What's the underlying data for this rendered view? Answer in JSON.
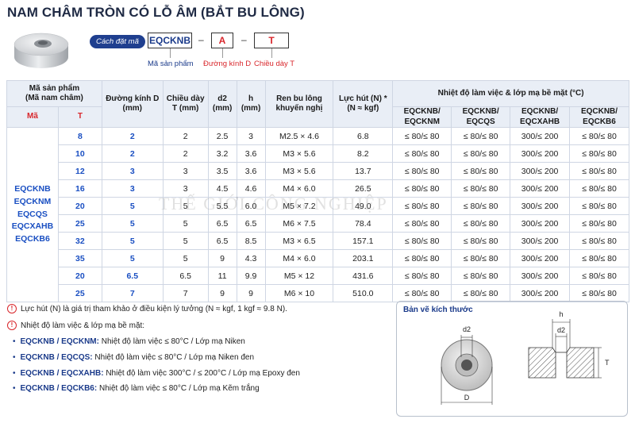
{
  "title": "NAM CHÂM TRÒN CÓ LỖ ÂM (BẮT BU LÔNG)",
  "code": {
    "label": "Cách đặt mã",
    "parts": [
      "EQCKNB",
      "A",
      "T"
    ],
    "captions": [
      "Mã sản phẩm",
      "Đường kính D",
      "Chiều dày T"
    ]
  },
  "table": {
    "headers": {
      "product": "Mã sản phẩm",
      "product_sub": "(Mã nam châm)",
      "ma": "Mã",
      "t": "T",
      "diameter": "Đường kính D",
      "diameter_unit": "(mm)",
      "thickness": "Chiều dày",
      "thickness_unit": "T (mm)",
      "d2": "d2",
      "d2_unit": "(mm)",
      "h": "h",
      "h_unit": "(mm)",
      "bolt": "Ren bu lông",
      "bolt_sub": "khuyến nghị",
      "force": "Lực hút (N) *",
      "force_sub": "(N ≈ kgf)",
      "temp_group": "Nhiệt độ làm việc & lớp mạ bề mặt (°C)",
      "temp_cols": [
        [
          "EQCKNB/",
          "EQCKNM"
        ],
        [
          "EQCKNB/",
          "EQCQS"
        ],
        [
          "EQCKNB/",
          "EQCXAHB"
        ],
        [
          "EQCKNB/",
          "EQCKB6"
        ]
      ]
    },
    "product_codes": [
      "EQCKNB",
      "EQCKNM",
      "EQCQS",
      "EQCXAHB",
      "EQCKB6"
    ],
    "rows": [
      {
        "t": "8",
        "d": "2",
        "thick": "2",
        "d2": "2.5",
        "h": "3",
        "bolt": "M2.5 × 4.6",
        "force": "6.8",
        "c1": "≤ 80/≤ 80",
        "c2": "≤ 80/≤ 80",
        "c3": "300/≤ 200",
        "c4": "≤ 80/≤ 80"
      },
      {
        "t": "10",
        "d": "2",
        "thick": "2",
        "d2": "3.2",
        "h": "3.6",
        "bolt": "M3 × 5.6",
        "force": "8.2",
        "c1": "≤ 80/≤ 80",
        "c2": "≤ 80/≤ 80",
        "c3": "300/≤ 200",
        "c4": "≤ 80/≤ 80"
      },
      {
        "t": "12",
        "d": "3",
        "thick": "3",
        "d2": "3.5",
        "h": "3.6",
        "bolt": "M3 × 5.6",
        "force": "13.7",
        "c1": "≤ 80/≤ 80",
        "c2": "≤ 80/≤ 80",
        "c3": "300/≤ 200",
        "c4": "≤ 80/≤ 80"
      },
      {
        "t": "16",
        "d": "3",
        "thick": "3",
        "d2": "4.5",
        "h": "4.6",
        "bolt": "M4 × 6.0",
        "force": "26.5",
        "c1": "≤ 80/≤ 80",
        "c2": "≤ 80/≤ 80",
        "c3": "300/≤ 200",
        "c4": "≤ 80/≤ 80"
      },
      {
        "t": "20",
        "d": "5",
        "thick": "5",
        "d2": "5.5",
        "h": "6.0",
        "bolt": "M5 × 7.2",
        "force": "49.0",
        "c1": "≤ 80/≤ 80",
        "c2": "≤ 80/≤ 80",
        "c3": "300/≤ 200",
        "c4": "≤ 80/≤ 80"
      },
      {
        "t": "25",
        "d": "5",
        "thick": "5",
        "d2": "6.5",
        "h": "6.5",
        "bolt": "M6 × 7.5",
        "force": "78.4",
        "c1": "≤ 80/≤ 80",
        "c2": "≤ 80/≤ 80",
        "c3": "300/≤ 200",
        "c4": "≤ 80/≤ 80"
      },
      {
        "t": "32",
        "d": "5",
        "thick": "5",
        "d2": "6.5",
        "h": "8.5",
        "bolt": "M3 × 6.5",
        "force": "157.1",
        "c1": "≤ 80/≤ 80",
        "c2": "≤ 80/≤ 80",
        "c3": "300/≤ 200",
        "c4": "≤ 80/≤ 80"
      },
      {
        "t": "35",
        "d": "5",
        "thick": "5",
        "d2": "9",
        "h": "4.3",
        "bolt": "M4 × 6.0",
        "force": "203.1",
        "c1": "≤ 80/≤ 80",
        "c2": "≤ 80/≤ 80",
        "c3": "300/≤ 200",
        "c4": "≤ 80/≤ 80"
      },
      {
        "t": "20",
        "d": "6.5",
        "thick": "6.5",
        "d2": "11",
        "h": "9.9",
        "bolt": "M5 × 12",
        "force": "431.6",
        "c1": "≤ 80/≤ 80",
        "c2": "≤ 80/≤ 80",
        "c3": "300/≤ 200",
        "c4": "≤ 80/≤ 80"
      },
      {
        "t": "25",
        "d": "7",
        "thick": "7",
        "d2": "9",
        "h": "9",
        "bolt": "M6 × 10",
        "force": "510.0",
        "c1": "≤ 80/≤ 80",
        "c2": "≤ 80/≤ 80",
        "c3": "300/≤ 200",
        "c4": "≤ 80/≤ 80"
      }
    ]
  },
  "watermark": "THẾ GIỚI CÔNG NGHIỆP",
  "notes": [
    "Lực hút (N) là giá trị tham khảo ở điều kiện lý tưởng (N ≈ kgf, 1 kgf ≈ 9.8 N).",
    "Nhiệt độ làm việc & lớp mạ bề mặt:"
  ],
  "bullets": [
    {
      "code": "EQCKNB / EQCKNM:",
      "text": "Nhiệt độ làm việc ≤ 80°C / Lớp mạ Niken"
    },
    {
      "code": "EQCKNB / EQCQS:",
      "text": "Nhiệt độ làm việc ≤ 80°C / Lớp mạ Niken đen"
    },
    {
      "code": "EQCKNB / EQCXAHB:",
      "text": "Nhiệt độ làm việc 300°C / ≤ 200°C / Lớp mạ Epoxy đen"
    },
    {
      "code": "EQCKNB / EQCKB6:",
      "text": "Nhiệt độ làm việc ≤ 80°C / Lớp mạ Kẽm trắng"
    }
  ],
  "drawing": {
    "title": "Bản vẽ kích thước",
    "labels": {
      "d2": "d2",
      "D": "D",
      "h": "h",
      "d2b": "d2",
      "T": "T"
    }
  },
  "colors": {
    "navy": "#1a3a8a",
    "blue": "#1a4fc2",
    "red": "#d8262b",
    "header_bg": "#e9eef6"
  }
}
